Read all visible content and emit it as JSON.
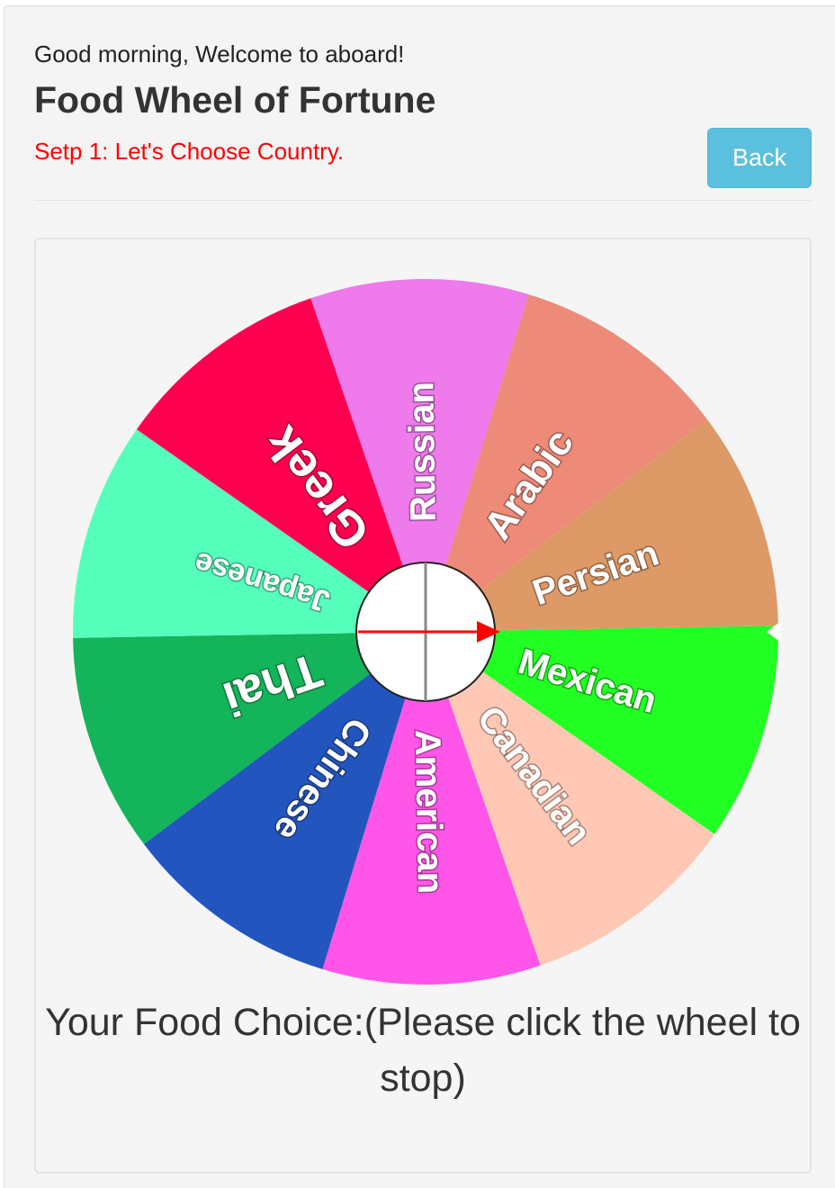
{
  "header": {
    "greeting": "Good morning, Welcome to aboard!",
    "title": "Food Wheel of Fortune",
    "step": "Setp 1: Let's Choose Country.",
    "back_label": "Back"
  },
  "colors": {
    "step_text": "#ff0000",
    "back_button": "#5bc0de",
    "pointer": "#ff0000"
  },
  "wheel": {
    "segments": [
      {
        "label": "Mexican",
        "color": "#22ff22",
        "text_color": "#ffffff"
      },
      {
        "label": "Canadian",
        "color": "#ffc8b4",
        "text_color": "#ffffff"
      },
      {
        "label": "American",
        "color": "#ff55e8",
        "text_color": "#ffffff"
      },
      {
        "label": "Chinese",
        "color": "#2355bf",
        "text_color": "#ffffff"
      },
      {
        "label": "Thai",
        "color": "#14b45a",
        "text_color": "#ffffff"
      },
      {
        "label": "Japanese",
        "color": "#55ffbb",
        "text_color": "#ffffff"
      },
      {
        "label": "Greek",
        "color": "#ff0050",
        "text_color": "#ffffff"
      },
      {
        "label": "Russian",
        "color": "#ee7aeb",
        "text_color": "#ffffff"
      },
      {
        "label": "Arabic",
        "color": "#ee8a78",
        "text_color": "#ffffff"
      },
      {
        "label": "Persian",
        "color": "#dd9966",
        "text_color": "#ffffff"
      }
    ]
  },
  "result": {
    "text": "Your Food Choice:(Please click the wheel to stop)"
  }
}
